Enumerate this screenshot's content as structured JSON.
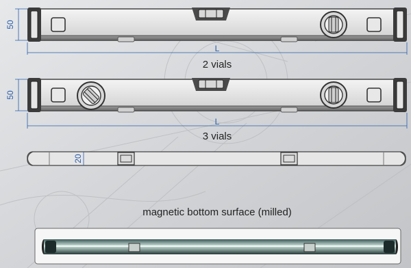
{
  "level_a": {
    "height_dim": "50",
    "length_dim": "L",
    "caption": "2 vials"
  },
  "level_b": {
    "height_dim": "50",
    "length_dim": "L",
    "caption": "3 vials"
  },
  "side_view": {
    "thickness_dim": "20"
  },
  "bottom_caption": "magnetic bottom surface (milled)"
}
